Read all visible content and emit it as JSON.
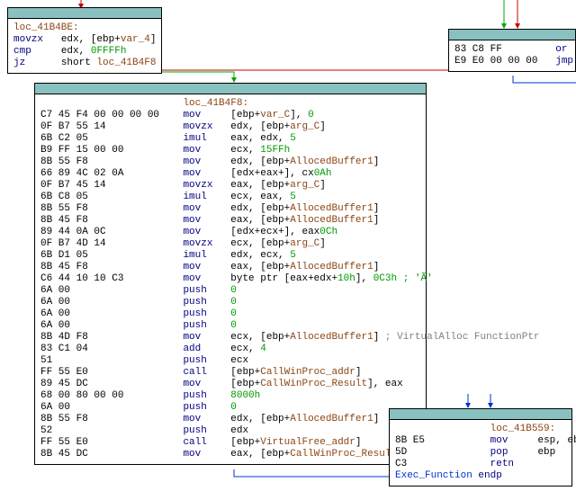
{
  "node1": {
    "label": "loc_41B4BE:",
    "l1_hex": "",
    "l1_mn": "movzx",
    "l1_ops_a": "edx, [ebp+",
    "l1_ops_b": "var_4",
    "l1_ops_c": "]",
    "l2_hex": "",
    "l2_mn": "cmp",
    "l2_ops_a": "edx, ",
    "l2_ops_b": "0FFFFh",
    "l3_hex": "",
    "l3_mn": "jz",
    "l3_ops_a": "short ",
    "l3_ops_b": "loc_41B4F8"
  },
  "node2": {
    "label_pad": "                        ",
    "label": "loc_41B4F8:",
    "lines": [
      {
        "hex": "C7 45 F4 00 00 00 00",
        "mn": "mov",
        "p1": "[ebp+",
        "nm": "var_C",
        "p2": "], ",
        "lit": "0"
      },
      {
        "hex": "0F B7 55 14",
        "mn": "movzx",
        "p1": "edx, [ebp+",
        "nm": "arg_C",
        "p2": "]",
        "lit": ""
      },
      {
        "hex": "6B C2 05",
        "mn": "imul",
        "p1": "eax, edx, ",
        "nm": "",
        "p2": "",
        "lit": "5"
      },
      {
        "hex": "B9 FF 15 00 00",
        "mn": "mov",
        "p1": "ecx, ",
        "nm": "",
        "p2": "",
        "lit": "15FFh"
      },
      {
        "hex": "8B 55 F8",
        "mn": "mov",
        "p1": "edx, [ebp+",
        "nm": "AllocedBuffer1",
        "p2": "]",
        "lit": ""
      },
      {
        "hex": "66 89 4C 02 0A",
        "mn": "mov",
        "p1": "[edx+eax+",
        "nm": "",
        "p2": "], cx",
        "lit": "0Ah"
      },
      {
        "hex": "0F B7 45 14",
        "mn": "movzx",
        "p1": "eax, [ebp+",
        "nm": "arg_C",
        "p2": "]",
        "lit": ""
      },
      {
        "hex": "6B C8 05",
        "mn": "imul",
        "p1": "ecx, eax, ",
        "nm": "",
        "p2": "",
        "lit": "5"
      },
      {
        "hex": "8B 55 F8",
        "mn": "mov",
        "p1": "edx, [ebp+",
        "nm": "AllocedBuffer1",
        "p2": "]",
        "lit": ""
      },
      {
        "hex": "8B 45 F8",
        "mn": "mov",
        "p1": "eax, [ebp+",
        "nm": "AllocedBuffer1",
        "p2": "]",
        "lit": ""
      },
      {
        "hex": "89 44 0A 0C",
        "mn": "mov",
        "p1": "[edx+ecx+",
        "nm": "",
        "p2": "], eax",
        "lit": "0Ch"
      },
      {
        "hex": "0F B7 4D 14",
        "mn": "movzx",
        "p1": "ecx, [ebp+",
        "nm": "arg_C",
        "p2": "]",
        "lit": ""
      },
      {
        "hex": "6B D1 05",
        "mn": "imul",
        "p1": "edx, ecx, ",
        "nm": "",
        "p2": "",
        "lit": "5"
      },
      {
        "hex": "8B 45 F8",
        "mn": "mov",
        "p1": "eax, [ebp+",
        "nm": "AllocedBuffer1",
        "p2": "]",
        "lit": ""
      },
      {
        "hex": "C6 44 10 10 C3",
        "mn": "mov",
        "p1": "byte ptr [eax+edx+",
        "nm": "",
        "p2": "], ",
        "lit": "10h",
        "tail": "0C3h ; 'Ã'"
      },
      {
        "hex": "6A 00",
        "mn": "push",
        "p1": "",
        "nm": "",
        "p2": "",
        "lit": "0"
      },
      {
        "hex": "6A 00",
        "mn": "push",
        "p1": "",
        "nm": "",
        "p2": "",
        "lit": "0"
      },
      {
        "hex": "6A 00",
        "mn": "push",
        "p1": "",
        "nm": "",
        "p2": "",
        "lit": "0"
      },
      {
        "hex": "6A 00",
        "mn": "push",
        "p1": "",
        "nm": "",
        "p2": "",
        "lit": "0"
      },
      {
        "hex": "8B 4D F8",
        "mn": "mov",
        "p1": "ecx, [ebp+",
        "nm": "AllocedBuffer1",
        "p2": "] ",
        "lit": "",
        "cmt": "; VirtualAlloc FunctionPtr"
      },
      {
        "hex": "83 C1 04",
        "mn": "add",
        "p1": "ecx, ",
        "nm": "",
        "p2": "",
        "lit": "4"
      },
      {
        "hex": "51",
        "mn": "push",
        "p1": "ecx",
        "nm": "",
        "p2": "",
        "lit": ""
      },
      {
        "hex": "FF 55 E0",
        "mn": "call",
        "p1": "[ebp+",
        "nm": "CallWinProc_addr",
        "p2": "]",
        "lit": ""
      },
      {
        "hex": "89 45 DC",
        "mn": "mov",
        "p1": "[ebp+",
        "nm": "CallWinProc_Result",
        "p2": "], eax",
        "lit": ""
      },
      {
        "hex": "68 00 80 00 00",
        "mn": "push",
        "p1": "",
        "nm": "",
        "p2": "",
        "lit": "8000h"
      },
      {
        "hex": "6A 00",
        "mn": "push",
        "p1": "",
        "nm": "",
        "p2": "",
        "lit": "0"
      },
      {
        "hex": "8B 55 F8",
        "mn": "mov",
        "p1": "edx, [ebp+",
        "nm": "AllocedBuffer1",
        "p2": "]",
        "lit": ""
      },
      {
        "hex": "52",
        "mn": "push",
        "p1": "edx",
        "nm": "",
        "p2": "",
        "lit": ""
      },
      {
        "hex": "FF 55 E0",
        "mn": "call",
        "p1": "[ebp+",
        "nm": "VirtualFree_addr",
        "p2": "]",
        "lit": ""
      },
      {
        "hex": "8B 45 DC",
        "mn": "mov",
        "p1": "eax, [ebp+",
        "nm": "CallWinProc_Result",
        "p2": "]",
        "lit": ""
      }
    ]
  },
  "node3": {
    "l1_hex": "83 C8 FF",
    "l1_mn": "or",
    "l2_hex": "E9 E0 00 00 00",
    "l2_mn": "jmp"
  },
  "node4": {
    "label_pad": "                ",
    "label": "loc_41B559:",
    "l1_hex": "8B E5",
    "l1_mn": "mov",
    "l1_ops": "esp, ebp",
    "l2_hex": "5D",
    "l2_mn": "pop",
    "l2_ops": "ebp",
    "l3_hex": "C3",
    "l3_mn": "retn",
    "l3_ops": "",
    "l4_lab": "Exec_Function",
    "l4_tail": " endp"
  }
}
